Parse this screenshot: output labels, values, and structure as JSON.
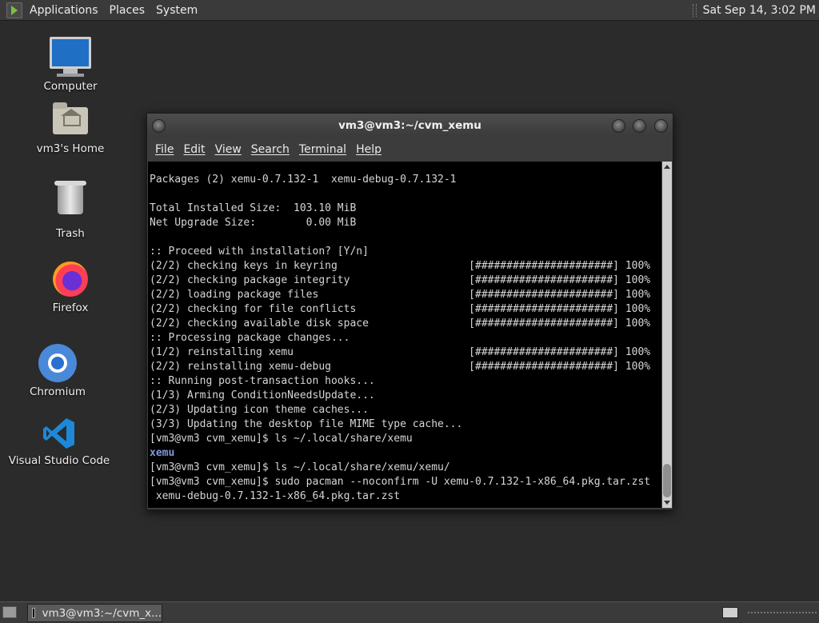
{
  "top_panel": {
    "menus": [
      "Applications",
      "Places",
      "System"
    ],
    "clock": "Sat Sep 14,  3:02 PM"
  },
  "desktop_icons": [
    {
      "label": "Computer",
      "icon": "computer-icon"
    },
    {
      "label": "vm3's Home",
      "icon": "home-folder-icon"
    },
    {
      "label": "Trash",
      "icon": "trash-icon"
    },
    {
      "label": "Firefox",
      "icon": "firefox-icon"
    },
    {
      "label": "Chromium",
      "icon": "chromium-icon"
    },
    {
      "label": "Visual Studio Code",
      "icon": "vscode-icon"
    }
  ],
  "terminal": {
    "title": "vm3@vm3:~/cvm_xemu",
    "menu": [
      "File",
      "Edit",
      "View",
      "Search",
      "Terminal",
      "Help"
    ],
    "lines": [
      "Packages (2) xemu-0.7.132-1  xemu-debug-0.7.132-1",
      "",
      "Total Installed Size:  103.10 MiB",
      "Net Upgrade Size:        0.00 MiB",
      "",
      ":: Proceed with installation? [Y/n]",
      "(2/2) checking keys in keyring                     [######################] 100%",
      "(2/2) checking package integrity                   [######################] 100%",
      "(2/2) loading package files                        [######################] 100%",
      "(2/2) checking for file conflicts                  [######################] 100%",
      "(2/2) checking available disk space                [######################] 100%",
      ":: Processing package changes...",
      "(1/2) reinstalling xemu                            [######################] 100%",
      "(2/2) reinstalling xemu-debug                      [######################] 100%",
      ":: Running post-transaction hooks...",
      "(1/3) Arming ConditionNeedsUpdate...",
      "(2/3) Updating icon theme caches...",
      "(3/3) Updating the desktop file MIME type cache...",
      "[vm3@vm3 cvm_xemu]$ ls ~/.local/share/xemu",
      "xemu",
      "[vm3@vm3 cvm_xemu]$ ls ~/.local/share/xemu/xemu/",
      "[vm3@vm3 cvm_xemu]$ sudo pacman --noconfirm -U xemu-0.7.132-1-x86_64.pkg.tar.zst",
      " xemu-debug-0.7.132-1-x86_64.pkg.tar.zst"
    ],
    "highlight_line_index": 19,
    "highlight_color": "#7e98d6"
  },
  "taskbar": {
    "task_label": "vm3@vm3:~/cvm_x..."
  },
  "colors": {
    "desktop_bg": "#2b2b2b",
    "panel_bg": "#3a3a3a",
    "terminal_bg": "#000000",
    "terminal_fg": "#d6d6d6"
  }
}
